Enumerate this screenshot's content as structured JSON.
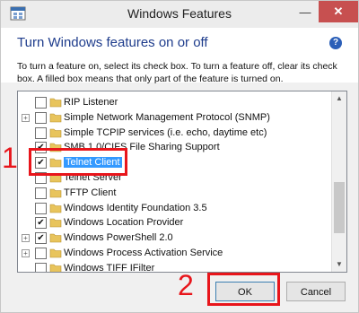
{
  "window": {
    "title": "Windows Features",
    "controls": {
      "minimize": "—",
      "close": "✕"
    }
  },
  "header": {
    "heading": "Turn Windows features on or off",
    "help": "?",
    "description": "To turn a feature on, select its check box. To turn a feature off, clear its check box. A filled box means that only part of the feature is turned on."
  },
  "features": [
    {
      "label": "RIP Listener",
      "expander": false,
      "checked": false,
      "selected": false
    },
    {
      "label": "Simple Network Management Protocol (SNMP)",
      "expander": true,
      "checked": false,
      "selected": false
    },
    {
      "label": "Simple TCPIP services (i.e. echo, daytime etc)",
      "expander": false,
      "checked": false,
      "selected": false
    },
    {
      "label": "SMB 1.0/CIFS File Sharing Support",
      "expander": false,
      "checked": true,
      "selected": false
    },
    {
      "label": "Telnet Client",
      "expander": false,
      "checked": true,
      "selected": true
    },
    {
      "label": "Telnet Server",
      "expander": false,
      "checked": false,
      "selected": false
    },
    {
      "label": "TFTP Client",
      "expander": false,
      "checked": false,
      "selected": false
    },
    {
      "label": "Windows Identity Foundation 3.5",
      "expander": false,
      "checked": false,
      "selected": false
    },
    {
      "label": "Windows Location Provider",
      "expander": false,
      "checked": true,
      "selected": false
    },
    {
      "label": "Windows PowerShell 2.0",
      "expander": true,
      "checked": true,
      "selected": false
    },
    {
      "label": "Windows Process Activation Service",
      "expander": true,
      "checked": false,
      "selected": false
    },
    {
      "label": "Windows TIFF IFilter",
      "expander": false,
      "checked": false,
      "selected": false
    }
  ],
  "annotations": {
    "step1": "1",
    "step2": "2",
    "color": "#e8151b"
  },
  "buttons": {
    "ok": "OK",
    "cancel": "Cancel"
  }
}
